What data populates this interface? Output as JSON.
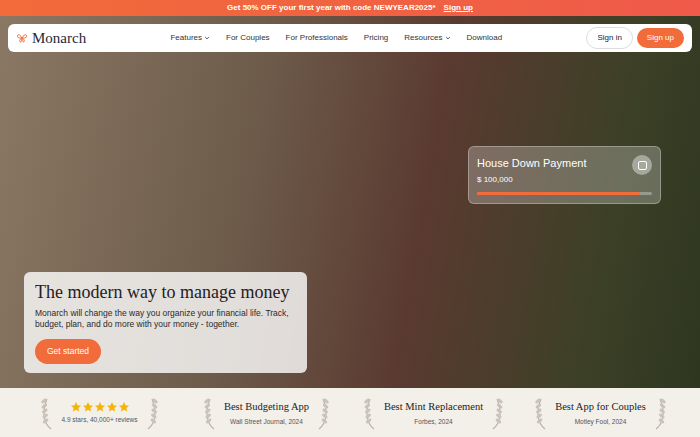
{
  "promo": {
    "text": "Get 50% OFF your first year with code NEWYEAR2025*",
    "link": "Sign up"
  },
  "nav": {
    "logo": "Monarch",
    "links": [
      {
        "label": "Features",
        "dropdown": true
      },
      {
        "label": "For Couples",
        "dropdown": false
      },
      {
        "label": "For Professionals",
        "dropdown": false
      },
      {
        "label": "Pricing",
        "dropdown": false
      },
      {
        "label": "Resources",
        "dropdown": true
      },
      {
        "label": "Download",
        "dropdown": false
      }
    ],
    "sign_in": "Sign in",
    "sign_up": "Sign up"
  },
  "goal_card": {
    "title": "House Down Payment",
    "amount": "$ 100,000",
    "level": 0.93
  },
  "hero": {
    "title": "The modern way to manage money",
    "body": "Monarch will change the way you organize your financial life. Track, budget, plan, and do more with your money - together.",
    "button": "Get started"
  },
  "awards": [
    {
      "kind": "rating",
      "stars": 5,
      "title": "",
      "caption": "4.9 stars, 40,000+ reviews"
    },
    {
      "kind": "award",
      "stars": 0,
      "title": "Best Budgeting App",
      "caption": "Wall Street Journal, 2024"
    },
    {
      "kind": "award",
      "stars": 0,
      "title": "Best Mint Replacement",
      "caption": "Forbes, 2024"
    },
    {
      "kind": "award",
      "stars": 0,
      "title": "Best App for Couples",
      "caption": "Motley Fool, 2024"
    }
  ]
}
